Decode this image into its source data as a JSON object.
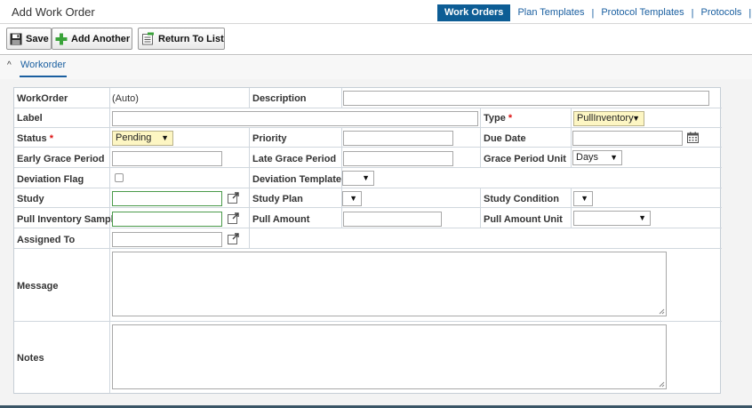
{
  "header": {
    "title": "Add Work Order"
  },
  "nav": {
    "tabs": [
      "Work Orders",
      "Plan Templates",
      "Protocol Templates",
      "Protocols"
    ],
    "separator": "|"
  },
  "toolbar": {
    "save": "Save",
    "add_another": "Add Another",
    "return_to_list": "Return To List"
  },
  "section": {
    "collapse_glyph": "^",
    "tab": "Workorder"
  },
  "form": {
    "workorder_label": "WorkOrder",
    "workorder_value": "(Auto)",
    "description_label": "Description",
    "label_label": "Label",
    "type_label": "Type",
    "type_value": "PullInventory",
    "status_label": "Status",
    "status_value": "Pending",
    "priority_label": "Priority",
    "due_date_label": "Due Date",
    "early_grace_label": "Early Grace Period",
    "late_grace_label": "Late Grace Period",
    "grace_unit_label": "Grace Period Unit",
    "grace_unit_value": "Days",
    "deviation_flag_label": "Deviation Flag",
    "deviation_template_label": "Deviation Template",
    "study_label": "Study",
    "study_plan_label": "Study Plan",
    "study_condition_label": "Study Condition",
    "pull_sample_label": "Pull Inventory Sample",
    "pull_amount_label": "Pull Amount",
    "pull_amount_unit_label": "Pull Amount Unit",
    "assigned_to_label": "Assigned To",
    "message_label": "Message",
    "notes_label": "Notes",
    "required_marker": "*",
    "dropdown_arrow": "▼"
  },
  "colors": {
    "accent": "#0d5d95",
    "link": "#1a5fa0",
    "required": "#dd1111",
    "highlight": "#fdf6c3"
  }
}
